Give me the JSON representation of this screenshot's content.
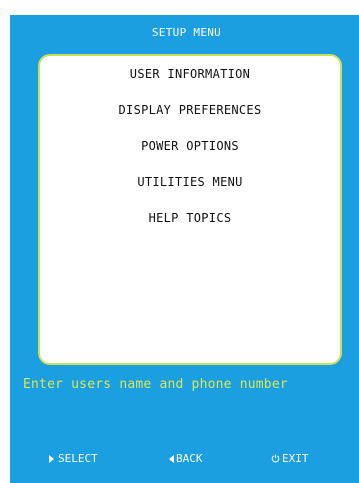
{
  "colors": {
    "background": "#1b9fe0",
    "menu_border": "#c8e05a",
    "help_text": "#d8e85a",
    "menu_fill": "#ffffff"
  },
  "header": {
    "title": "SETUP MENU"
  },
  "menu": {
    "items": [
      {
        "label": "USER INFORMATION"
      },
      {
        "label": "DISPLAY PREFERENCES"
      },
      {
        "label": "POWER OPTIONS"
      },
      {
        "label": "UTILITIES MENU"
      },
      {
        "label": "HELP TOPICS"
      }
    ]
  },
  "status": {
    "help_text": "Enter users name and phone number"
  },
  "footer": {
    "select": {
      "label": "SELECT",
      "icon": "triangle-right-icon"
    },
    "back": {
      "label": "BACK",
      "icon": "triangle-left-icon"
    },
    "exit": {
      "label": "EXIT",
      "icon": "power-icon"
    }
  }
}
